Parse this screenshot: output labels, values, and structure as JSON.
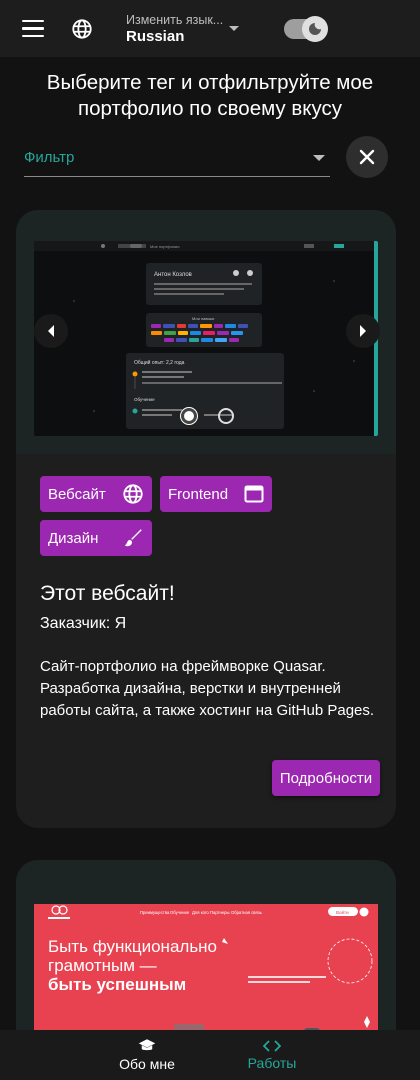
{
  "header": {
    "language_caption": "Изменить язык...",
    "language_value": "Russian",
    "icons": [
      "menu-icon",
      "globe-icon",
      "chevron-down-icon",
      "theme-toggle-moon-icon"
    ],
    "theme_toggle_on": true
  },
  "page_title": "Выберите тег и отфильтруйте мое портфолио по своему вкусу",
  "filter": {
    "label": "Фильтр",
    "clear_icon": "close-icon"
  },
  "projects": [
    {
      "tags": [
        {
          "label": "Вебсайт",
          "icon": "globe-icon"
        },
        {
          "label": "Frontend",
          "icon": "window-icon"
        },
        {
          "label": "Дизайн",
          "icon": "brush-icon"
        }
      ],
      "title": "Этот вебсайт!",
      "customer": "Заказчик: Я",
      "description": "Сайт-портфолио на фреймворке Quasar. Разработка дизайна, верстки и внутренней работы сайта, а также хостинг на GitHub Pages.",
      "details_label": "Подробности",
      "carousel": {
        "slides": 2,
        "active": 1
      },
      "screenshot": {
        "nav_label": "Мое портфолио",
        "name": "Антон Козлов",
        "skills_heading": "Мои навыки",
        "experience_heading": "Общий опыт: 2,2 года",
        "education_heading": "Обучение"
      }
    },
    {
      "screenshot": {
        "headline_1": "Быть функционально",
        "headline_2": "грамотным —",
        "headline_3": "быть успешным",
        "nav_items": [
          "Преимущества",
          "Обучение",
          "Для кого",
          "Партнеры",
          "Обратная связь"
        ],
        "login_label": "Войти"
      }
    }
  ],
  "bottom_nav": [
    {
      "label": "Обо мне",
      "icon": "graduation-cap-icon"
    },
    {
      "label": "Работы",
      "icon": "code-icon",
      "active": true
    }
  ],
  "colors": {
    "background": "#121212",
    "header": "#1d1d1d",
    "accent": "#26a69a",
    "chip": "#9c27b0",
    "card": "#1e1e1e"
  }
}
